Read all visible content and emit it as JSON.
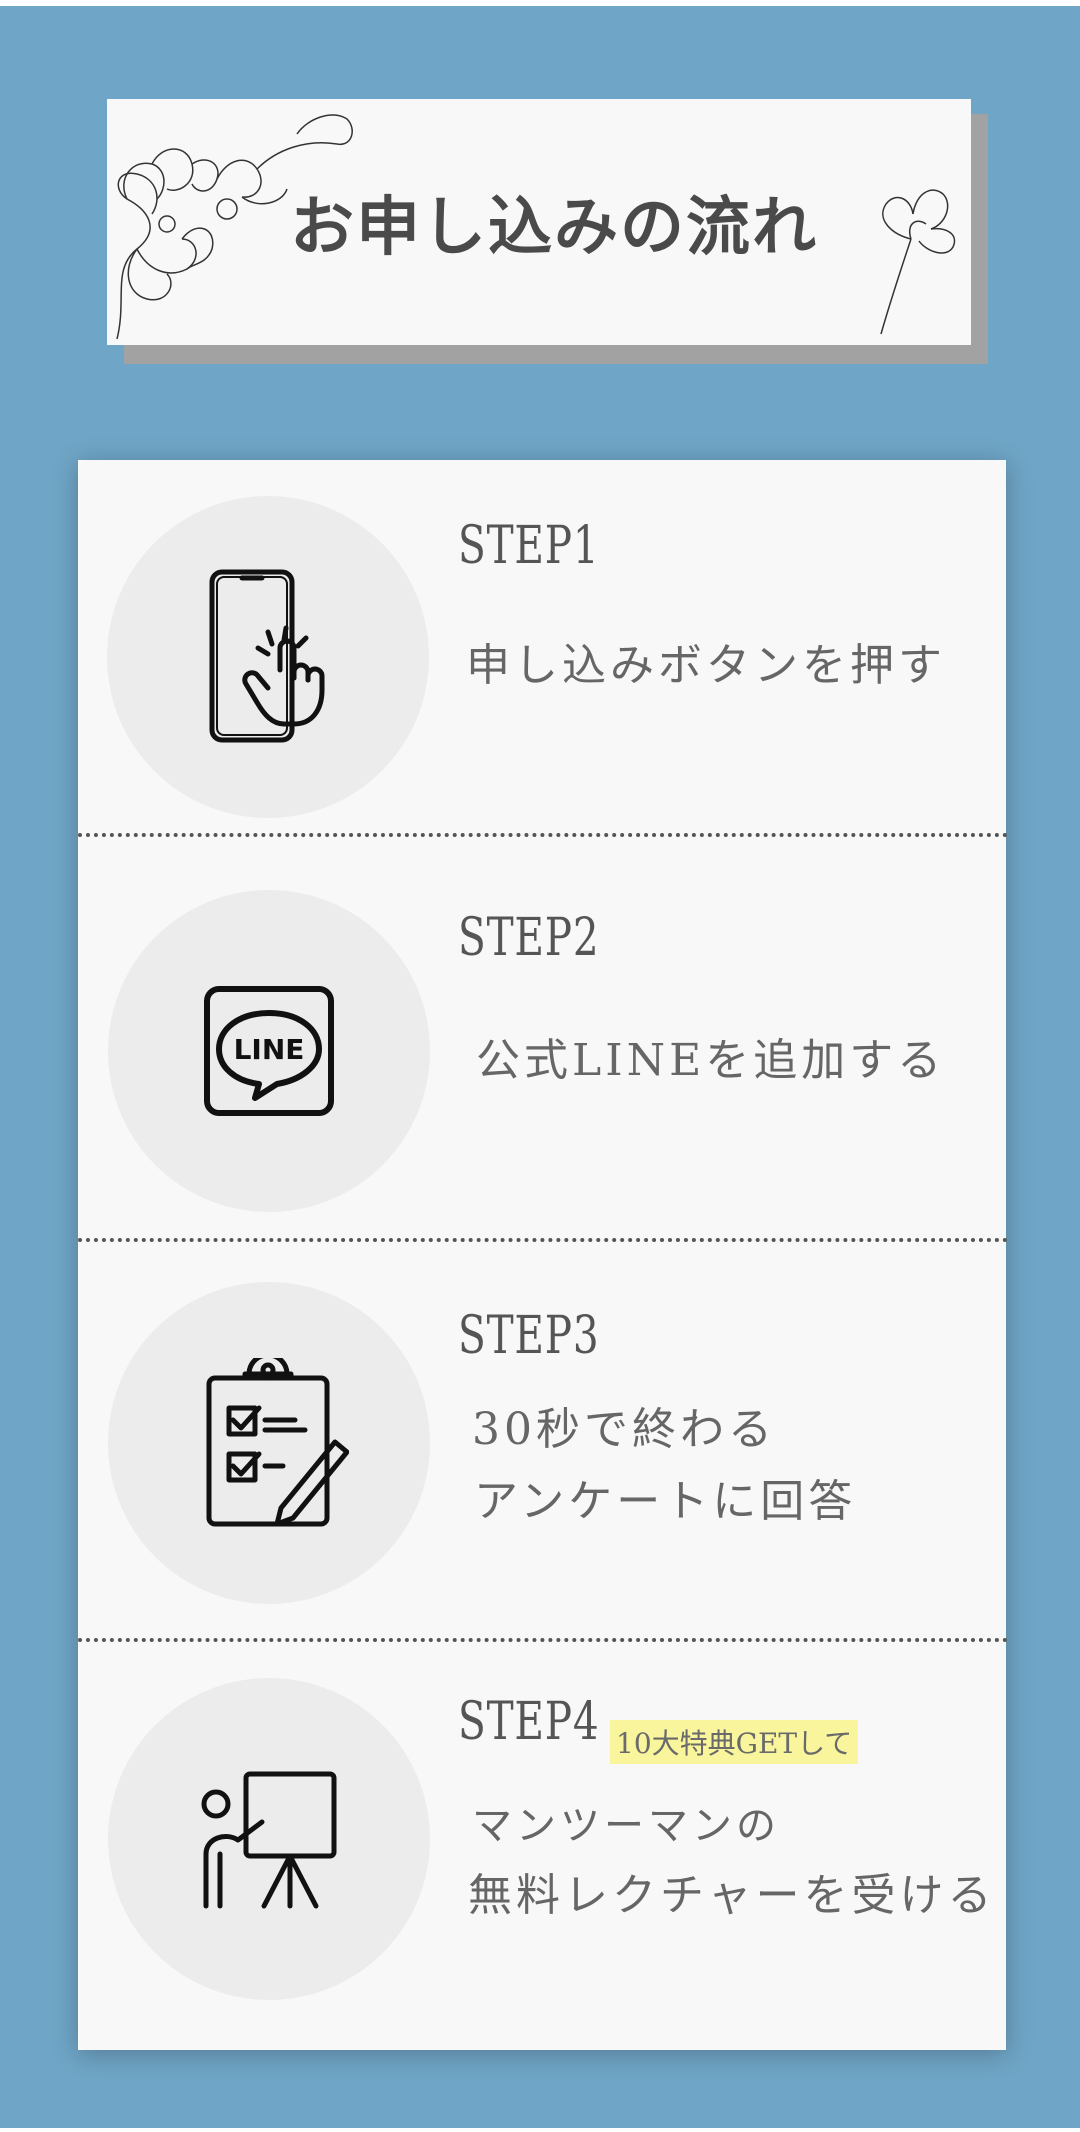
{
  "title": "お申し込みの流れ",
  "steps": [
    {
      "label": "STEP1",
      "lines": [
        "申し込みボタンを押す"
      ],
      "icon": "phone-tap-icon"
    },
    {
      "label": "STEP2",
      "lines": [
        "公式LINEを追加する"
      ],
      "icon": "line-app-icon",
      "icon_text": "LINE"
    },
    {
      "label": "STEP3",
      "lines": [
        "30秒で終わる",
        "アンケートに回答"
      ],
      "icon": "clipboard-checklist-icon"
    },
    {
      "label": "STEP4",
      "badge": "10大特典GETして",
      "lines": [
        "マンツーマンの",
        "無料レクチャーを受ける"
      ],
      "icon": "presenter-board-icon"
    }
  ],
  "colors": {
    "background": "#6fa5c6",
    "card": "#f9f8f8",
    "circle": "#ececec",
    "badge_highlight": "#f8f59c"
  }
}
